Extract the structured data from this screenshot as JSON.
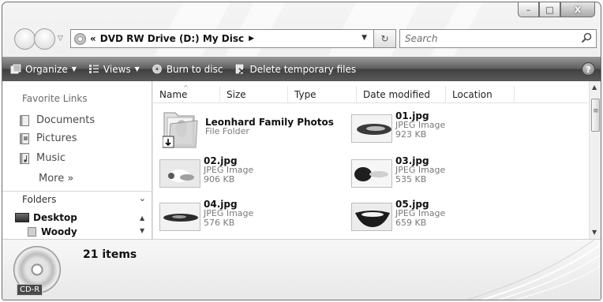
{
  "window": {
    "caption": {
      "minimize": "–",
      "maximize": "□",
      "close": "X"
    }
  },
  "address_bar": {
    "chevron": "«",
    "path": "DVD RW Drive (D:) My Disc",
    "crumb_arrow": "▶",
    "dropdown": "▼",
    "refresh_symbol": "↻",
    "icon": "cd-drive-icon"
  },
  "search": {
    "placeholder": "Search"
  },
  "toolbar": {
    "organize": "Organize",
    "views": "Views",
    "burn": "Burn to disc",
    "delete_temp": "Delete temporary files",
    "help": "?"
  },
  "nav_pane": {
    "favorites_title": "Favorite Links",
    "favorites": [
      {
        "label": "Documents",
        "icon": "documents-icon"
      },
      {
        "label": "Pictures",
        "icon": "pictures-icon"
      },
      {
        "label": "Music",
        "icon": "music-icon"
      }
    ],
    "more": "More  »",
    "folders_title": "Folders",
    "folders_chevron": "⌄",
    "tree": [
      {
        "label": "Desktop",
        "icon": "desktop-icon"
      },
      {
        "label": "Woody",
        "icon": "user-folder-icon"
      }
    ]
  },
  "columns": [
    "Name",
    "Size",
    "Type",
    "Date modified",
    "Location"
  ],
  "files": [
    {
      "name": "Leonhard Family Photos",
      "type": "File Folder",
      "size": ""
    },
    {
      "name": "01.jpg",
      "type": "JPEG Image",
      "size": "923 KB"
    },
    {
      "name": "02.jpg",
      "type": "JPEG Image",
      "size": "906 KB"
    },
    {
      "name": "03.jpg",
      "type": "JPEG Image",
      "size": "535 KB"
    },
    {
      "name": "04.jpg",
      "type": "JPEG Image",
      "size": "576 KB"
    },
    {
      "name": "05.jpg",
      "type": "JPEG Image",
      "size": "659 KB"
    }
  ],
  "details": {
    "count": "21 items",
    "disc_label": "CD-R"
  }
}
